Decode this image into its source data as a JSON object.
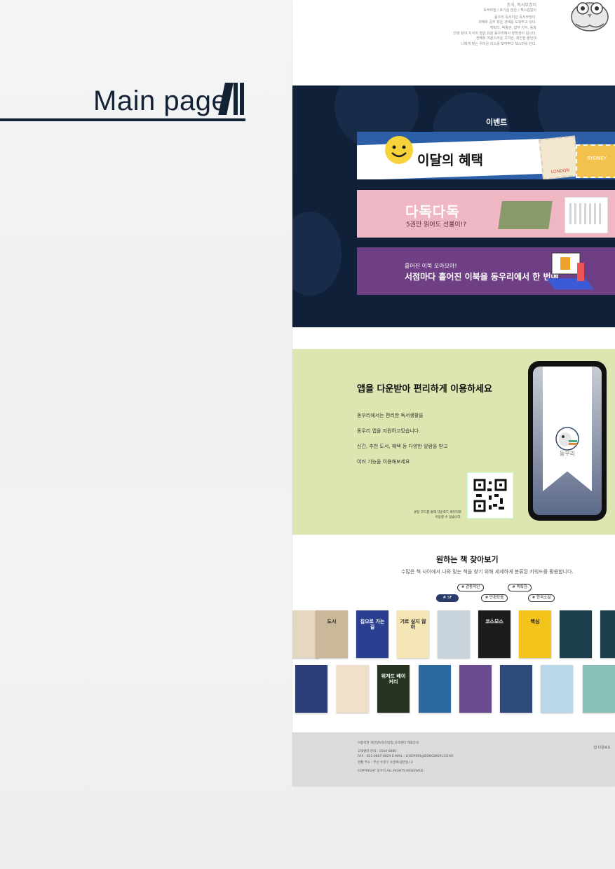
{
  "portfolio": {
    "title": "Main page"
  },
  "intro": {
    "lines": [
      "조식, 독서부엉이",
      "독부리잠 / 호기심 많은 / 책스컴덩이",
      "동우리 독서이던 독서부엉이.",
      "과제와 공부 같은 과제를 도와주고 있다.",
      "캐릭터, 박물관, 잡부 지식, 동화",
      "다양 분야 지식이 많은 유분 동우리에서 장학생이 됩니다.",
      "전해져 여분스러운 끄지만, 최진한 분인데",
      "나에게 맞는 우머운 미스를 보여주다 책스러워 한다."
    ]
  },
  "events": {
    "title": "이벤트",
    "banner1": {
      "label": "이달의 혜택",
      "stamp_text": "SYDNEY",
      "stamp_text2": "LONDON"
    },
    "banner2": {
      "title": "다독다독",
      "subtitle": "5권만 읽어도 선물이!?"
    },
    "banner3": {
      "line1": "흩어진 이북 모아모아!",
      "line2": "서점마다 흩어진 이북을 동우리에서 한 번에"
    }
  },
  "app": {
    "heading": "앱을 다운받아 편리하게 이용하세요",
    "lines": [
      "동우리에서는 편리한 독서생활을",
      "동우리 앱을 지원하고있습니다.",
      "신간, 추천 도서, 혜택 등 다양한 알람을 받고",
      "여러 기능을 이용해보세요"
    ],
    "qr_caption_1": "큐알 코드를 통해 다운로드 페이지로",
    "qr_caption_2": "이동할 수 있습니다.",
    "brand": "동우리"
  },
  "books": {
    "heading": "원하는 책 찾아보기",
    "subheading": "수많은 책 사이에서 나와 맞는 책을 찾기 위해 세세하게 분류된 키워드를 활용합니다.",
    "keywords_row1": [
      "# 감동적인",
      "# 독특한"
    ],
    "keywords_row2": [
      "# SF",
      "# 단편모음",
      "# 한국소설"
    ],
    "covers_row1": [
      "",
      "도시",
      "집으로 가는 길",
      "기르 싶지 않아",
      "",
      "코스모스",
      "핵심",
      ""
    ],
    "covers_row2": [
      "",
      "",
      "위저드 베이커리",
      "",
      "",
      "",
      "",
      ""
    ],
    "colors_row1": [
      "#e6d7c1",
      "#c9b99a",
      "#2a3f8f",
      "#f4e6b5",
      "#c8d3dc",
      "#1c1c1c",
      "#f2c31b",
      "#1a3e4a"
    ],
    "colors_row2": [
      "#2b3e7a",
      "#f1e0c9",
      "#26341f",
      "#2a6aa0",
      "#6a4b8f",
      "#2c4a7a",
      "#b8d7e9",
      "#88c2b8"
    ]
  },
  "footer": {
    "links": "이용약관    개인정보처리방침    고객센터    제휴문의",
    "line1": "고객센터 문의 : 1544-0880",
    "line2": "FAX : 051-0807-8829    E-MAIL : LIVEPRRR@DONGWURI.CO.KR",
    "line3": "현황 주소 : 부산 수영구 수영로(광안동) 3",
    "copyright": "COPYRIGHT 동우리 ALL RIGHTS RESERVED.",
    "right": "앱 다운로드"
  }
}
